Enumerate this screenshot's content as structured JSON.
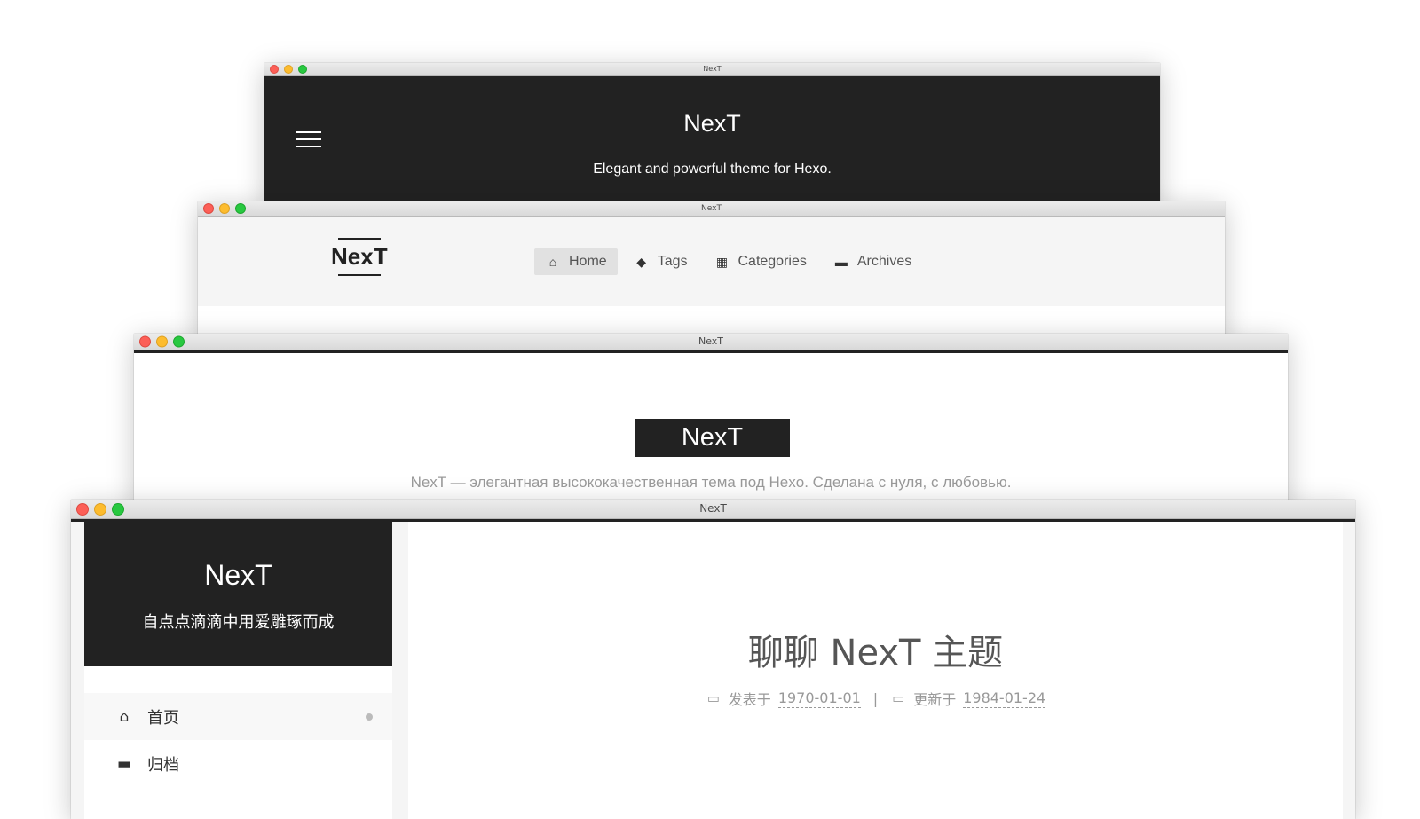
{
  "window_title": "NexT",
  "windows": {
    "muse": {
      "site_title": "NexT",
      "subtitle": "Elegant and powerful theme for Hexo.",
      "menu_icon": "hamburger-menu-icon"
    },
    "mist": {
      "logo": "NexT",
      "menu": [
        {
          "label": "Home",
          "icon": "home-icon",
          "glyph": "⌂",
          "active": true
        },
        {
          "label": "Tags",
          "icon": "tags-icon",
          "glyph": "◆",
          "active": false
        },
        {
          "label": "Categories",
          "icon": "grid-icon",
          "glyph": "▦",
          "active": false
        },
        {
          "label": "Archives",
          "icon": "archive-icon",
          "glyph": "▬",
          "active": false
        }
      ]
    },
    "pisces_lite": {
      "logo": "NexT",
      "description": "NexT — элегантная высококачественная тема под Hexo. Сделана с нуля, с любовью."
    },
    "pisces": {
      "site_title": "NexT",
      "subtitle": "自点点滴滴中用爱雕琢而成",
      "nav": [
        {
          "label": "首页",
          "icon": "home-icon",
          "glyph": "⌂",
          "active": true
        },
        {
          "label": "归档",
          "icon": "archive-icon",
          "glyph": "▬",
          "active": false
        }
      ],
      "post": {
        "title": "聊聊 NexT 主题",
        "posted_label": "发表于",
        "posted_date": "1970-01-01",
        "separator": "|",
        "updated_label": "更新于",
        "updated_date": "1984-01-24"
      }
    }
  },
  "colors": {
    "dark": "#222222",
    "header_light": "#f5f5f5",
    "traffic_red": "#fc5f57",
    "traffic_yellow": "#fdbc2e",
    "traffic_green": "#28c840"
  }
}
